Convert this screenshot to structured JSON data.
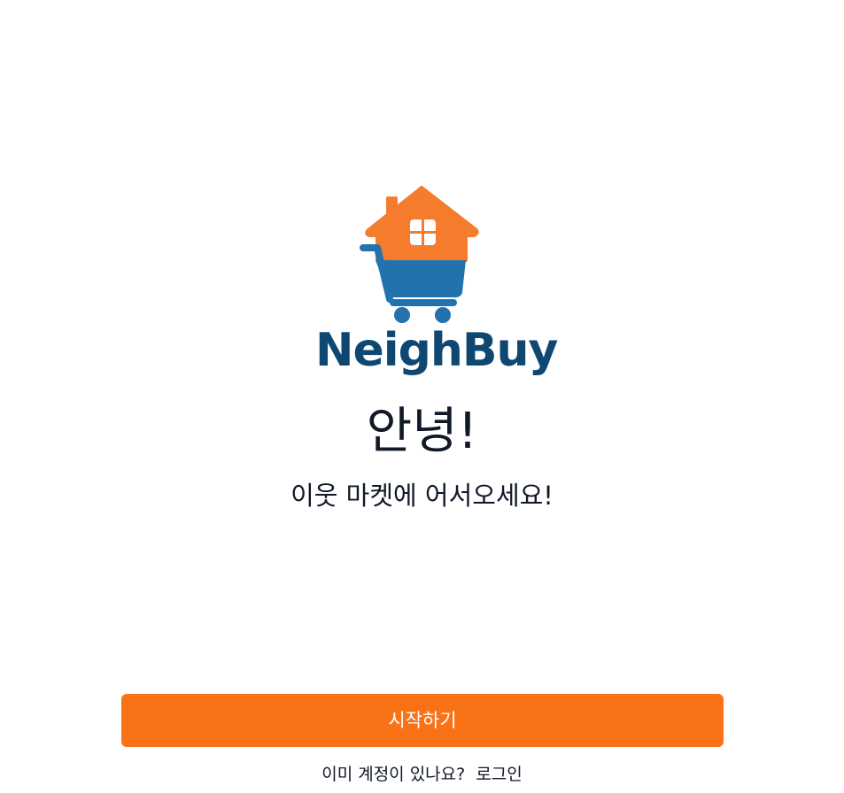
{
  "brand": {
    "name": "NeighBuy",
    "logo_icon": "house-shopping-cart-icon",
    "colors": {
      "house": "#f47c2c",
      "cart": "#2172ad",
      "wordmark": "#0e4872"
    }
  },
  "welcome": {
    "greeting": "안녕!",
    "subtitle": "이웃 마켓에 어서오세요!"
  },
  "actions": {
    "start_label": "시작하기",
    "start_color": "#f97316",
    "login_prompt": "이미 계정이 있나요?",
    "login_label": "로그인"
  }
}
